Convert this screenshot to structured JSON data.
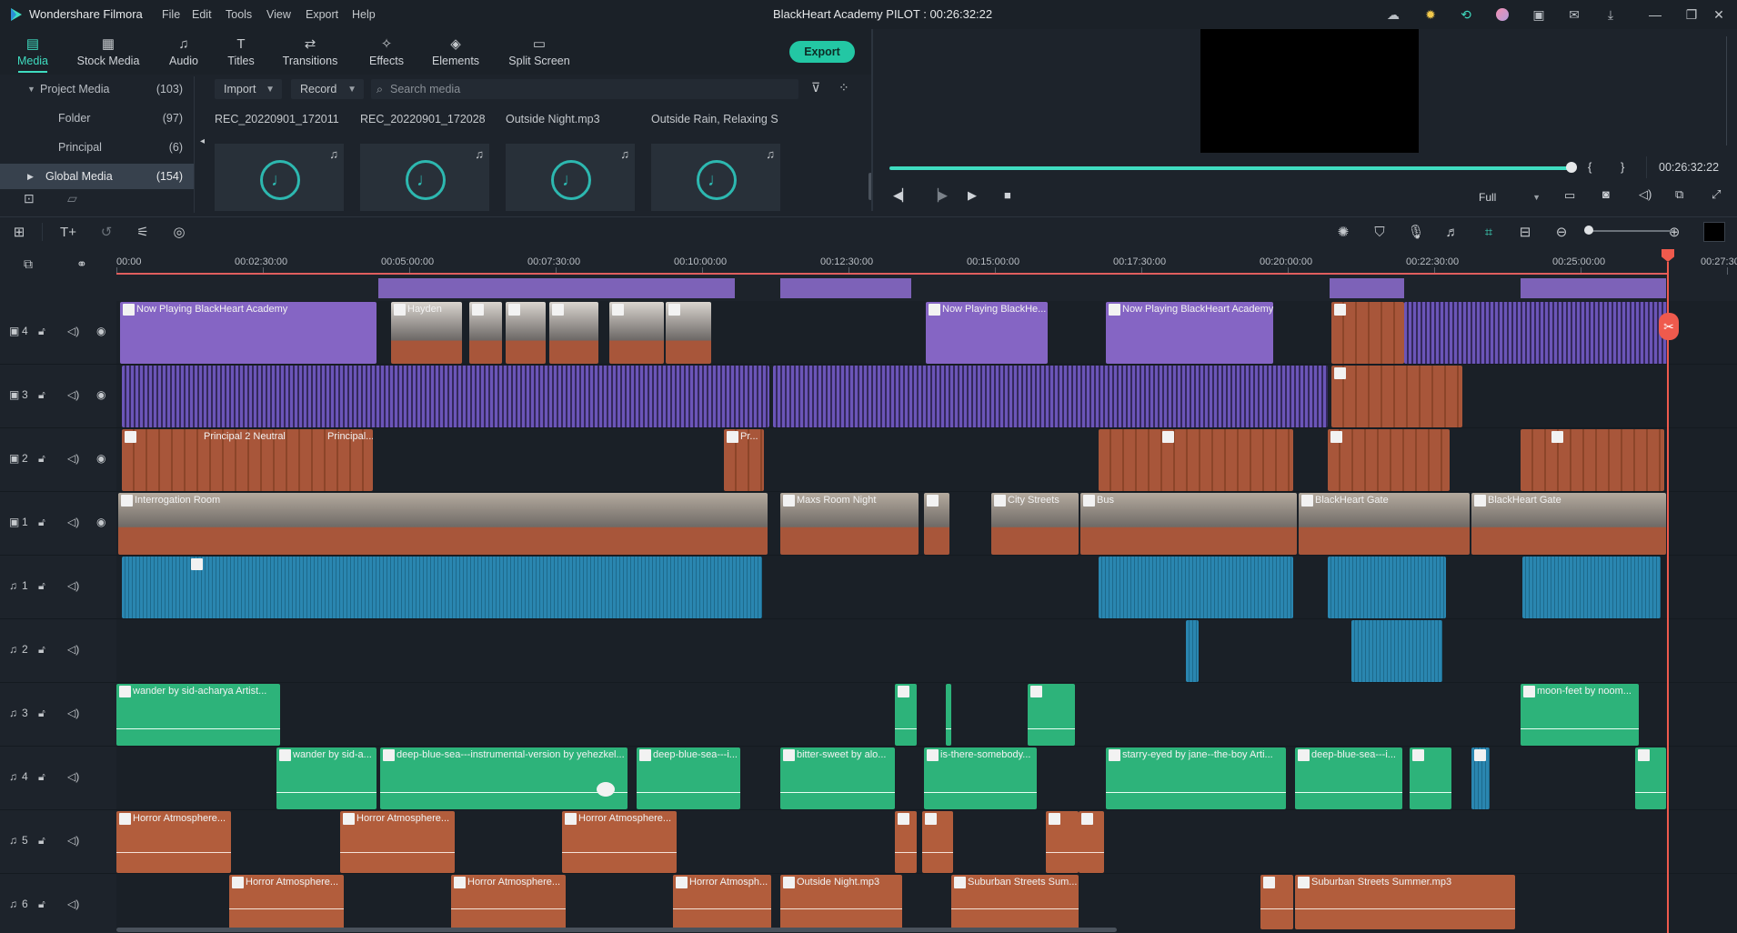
{
  "app": {
    "name": "Wondershare Filmora",
    "project_title": "BlackHeart Academy PILOT : 00:26:32:22",
    "menu": [
      "File",
      "Edit",
      "Tools",
      "View",
      "Export",
      "Help"
    ]
  },
  "tabs": [
    {
      "label": "Media",
      "icon": "folder-icon",
      "active": true
    },
    {
      "label": "Stock Media",
      "icon": "stock-icon"
    },
    {
      "label": "Audio",
      "icon": "music-note-icon"
    },
    {
      "label": "Titles",
      "icon": "text-icon"
    },
    {
      "label": "Transitions",
      "icon": "transition-icon"
    },
    {
      "label": "Effects",
      "icon": "effects-icon"
    },
    {
      "label": "Elements",
      "icon": "elements-icon"
    },
    {
      "label": "Split Screen",
      "icon": "split-screen-icon"
    }
  ],
  "export_label": "Export",
  "library": {
    "items": [
      {
        "label": "Project Media",
        "count": "(103)"
      },
      {
        "label": "Folder",
        "count": "(97)"
      },
      {
        "label": "Principal",
        "count": "(6)"
      },
      {
        "label": "Global Media",
        "count": "(154)"
      }
    ],
    "import_label": "Import",
    "record_label": "Record",
    "search_placeholder": "Search media"
  },
  "media": [
    {
      "name": "REC_20220901_172011"
    },
    {
      "name": "REC_20220901_172028"
    },
    {
      "name": "Outside Night.mp3"
    },
    {
      "name": "Outside Rain, Relaxing Sl..."
    }
  ],
  "preview": {
    "timecode": "00:26:32:22",
    "quality": "Full",
    "progress": 1.0
  },
  "ruler": {
    "labels": [
      "00:00",
      "00:02:30:00",
      "00:05:00:00",
      "00:07:30:00",
      "00:10:00:00",
      "00:12:30:00",
      "00:15:00:00",
      "00:17:30:00",
      "00:20:00:00",
      "00:22:30:00",
      "00:25:00:00",
      "00:27:30"
    ]
  },
  "tracks": [
    {
      "id": "video-4",
      "label": "4",
      "type": "video"
    },
    {
      "id": "video-3",
      "label": "3",
      "type": "video"
    },
    {
      "id": "video-2",
      "label": "2",
      "type": "video"
    },
    {
      "id": "video-1",
      "label": "1",
      "type": "video"
    },
    {
      "id": "audio-1",
      "label": "1",
      "type": "audio"
    },
    {
      "id": "audio-2",
      "label": "2",
      "type": "audio"
    },
    {
      "id": "audio-3",
      "label": "3",
      "type": "audio"
    },
    {
      "id": "audio-4",
      "label": "4",
      "type": "audio"
    },
    {
      "id": "audio-5",
      "label": "5",
      "type": "audio"
    },
    {
      "id": "audio-6",
      "label": "6",
      "type": "audio"
    }
  ],
  "clip_labels": {
    "now_playing": "Now Playing BlackHeart Academy",
    "now_playing_short": "Now Playing BlackHe...",
    "hayden": "Hayden",
    "principal_2": "Principal 2 Neutral",
    "principal_short": "Principal...",
    "pr_short": "Pr...",
    "interrogation": "Interrogation Room",
    "maxs_room": "Maxs Room Night",
    "city_streets": "City Streets",
    "bus": "Bus",
    "blackheart_gate": "BlackHeart Gate",
    "wander": "wander by sid-acharya Artist...",
    "wander_short": "wander by sid-a...",
    "deep_blue": "deep-blue-sea---instrumental-version by yehezkel...",
    "deep_blue_short": "deep-blue-sea---i...",
    "bitter_sweet": "bitter-sweet by alo...",
    "is_there": "is-there-somebody...",
    "starry_eyed": "starry-eyed by jane--the-boy Arti...",
    "moon_feet": "moon-feet by noom...",
    "horror": "Horror Atmosphere...",
    "horror_short": "Horror Atmosph...",
    "outside_night": "Outside Night.mp3",
    "suburban": "Suburban Streets Sum...",
    "suburban_full": "Suburban Streets Summer.mp3"
  },
  "colors": {
    "accent": "#3fdcc0",
    "playhead": "#ef5a4d",
    "title_clip": "#8565c4",
    "audio_green": "#2db37a",
    "audio_orange": "#b25d3c",
    "audio_blue": "#2a86b0"
  }
}
